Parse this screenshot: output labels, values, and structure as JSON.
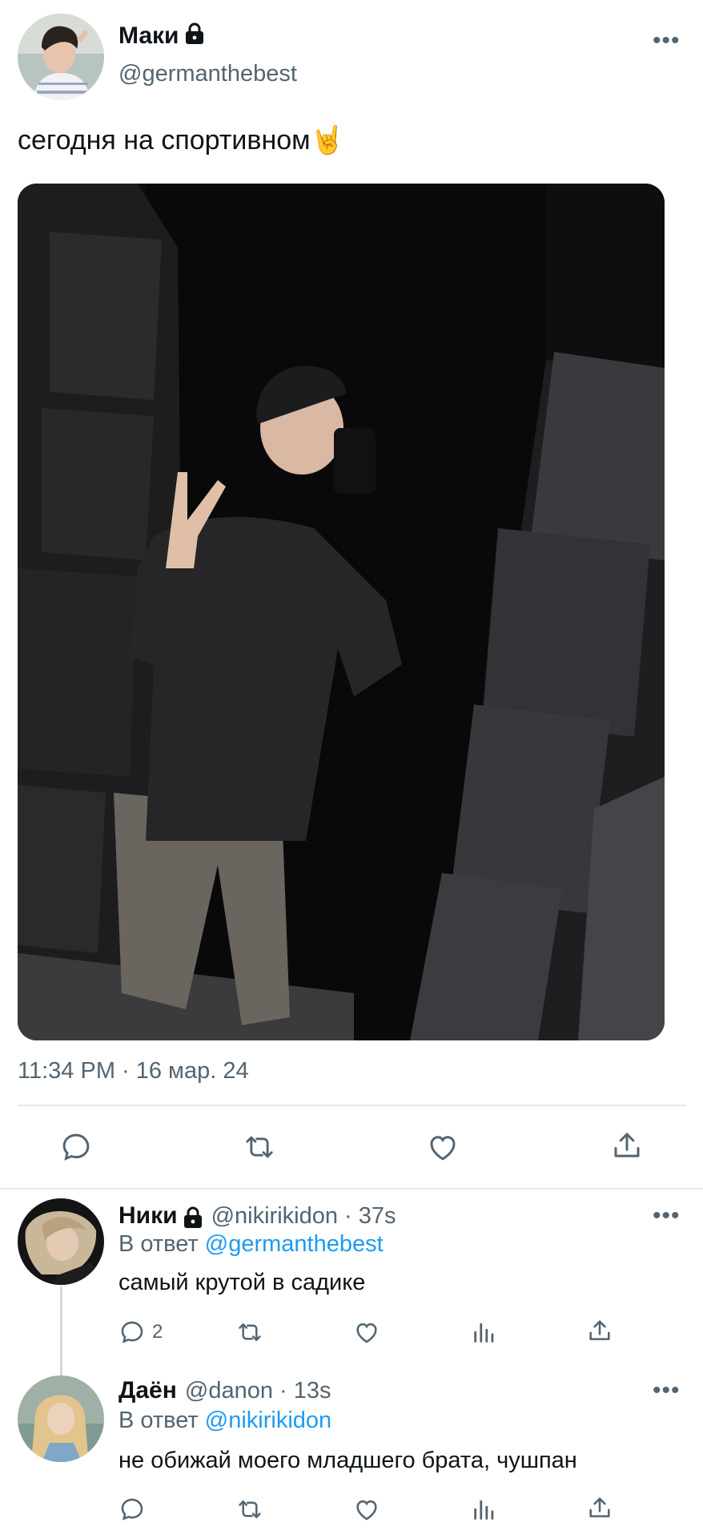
{
  "main_tweet": {
    "display_name": "Маки",
    "handle": "@germanthebest",
    "text": "сегодня на спортивном🤘",
    "timestamp": "11:34 PM · 16 мар. 24",
    "more_label": "•••",
    "actions": [
      "reply-icon",
      "retweet-icon",
      "like-icon",
      "share-icon"
    ]
  },
  "replies": [
    {
      "display_name": "Ники",
      "handle_time": "@nikirikidon · 37s",
      "reply_prefix": "В ответ",
      "reply_to": "@germanthebest",
      "text": "самый крутой в садике",
      "reply_count": "2",
      "more_label": "•••"
    },
    {
      "display_name": "Даён",
      "handle_time": "@danon · 13s",
      "reply_prefix": "В ответ",
      "reply_to": "@nikirikidon",
      "text": "не обижай моего младшего брата, чушпан",
      "reply_count": "",
      "more_label": "•••"
    }
  ],
  "colors": {
    "text": "#0f1419",
    "muted": "#536471",
    "link": "#1d9bf0",
    "divider": "#e6e9ec"
  }
}
